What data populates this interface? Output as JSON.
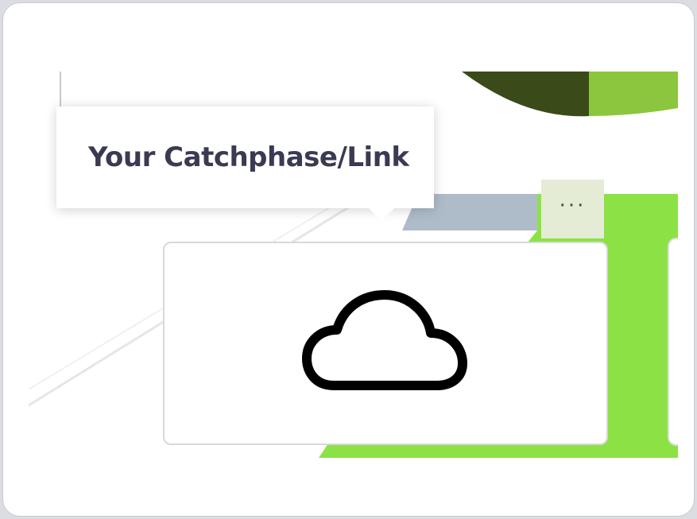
{
  "tooltip": {
    "text": "Your Catchphase/Link"
  },
  "more_button": {
    "label": "···",
    "icon": "more-horizontal-icon"
  },
  "card": {
    "icon": "cloud-icon"
  },
  "colors": {
    "accent_green": "#8ce244",
    "dark_green": "#3a4b19",
    "mid_green": "#8cc63e",
    "slate_blue": "#aebbc9",
    "more_button_bg": "#e4ecd5",
    "tooltip_text": "#3a3a52"
  }
}
